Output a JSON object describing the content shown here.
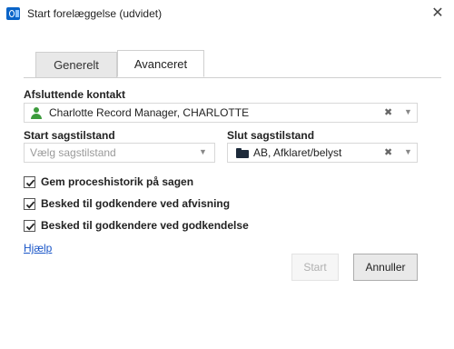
{
  "window": {
    "title": "Start forelæggelse (udvidet)",
    "close_symbol": "✕"
  },
  "tabs": [
    {
      "label": "Generelt",
      "active": false
    },
    {
      "label": "Avanceret",
      "active": true
    }
  ],
  "closing_contact": {
    "label": "Afsluttende kontakt",
    "value": "Charlotte Record Manager, CHARLOTTE",
    "icon": "person-icon"
  },
  "start_state": {
    "label": "Start sagstilstand",
    "placeholder": "Vælg sagstilstand"
  },
  "end_state": {
    "label": "Slut sagstilstand",
    "value": "AB, Afklaret/belyst",
    "icon": "folder-icon"
  },
  "clear_symbol": "✖",
  "dropdown_symbol": "▼",
  "checkboxes": [
    {
      "label": "Gem proceshistorik på sagen",
      "checked": true
    },
    {
      "label": "Besked til godkendere ved afvisning",
      "checked": true
    },
    {
      "label": "Besked til godkendere ved godkendelse",
      "checked": true
    }
  ],
  "help_link": "Hjælp",
  "buttons": {
    "start": "Start",
    "start_enabled": false,
    "cancel": "Annuller"
  },
  "colors": {
    "accent": "#0a64c8",
    "contact_icon": "#3c9b3c",
    "link": "#1a56c8"
  }
}
